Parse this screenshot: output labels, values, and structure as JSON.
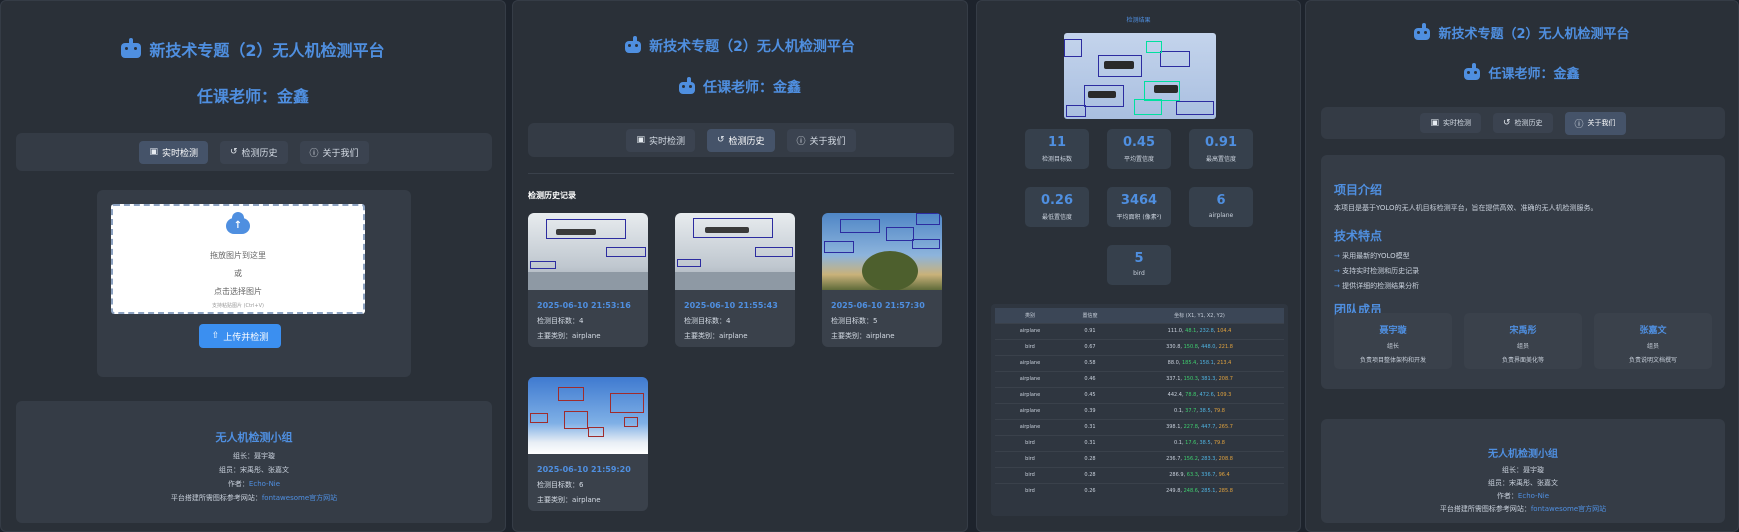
{
  "app": {
    "title": "新技术专题（2）无人机检测平台",
    "teacher": "任课老师：金鑫"
  },
  "nav": {
    "realtime": "实时检测",
    "history": "检测历史",
    "about": "关于我们"
  },
  "upload": {
    "drag_text": "拖放图片到这里",
    "or_text": "或",
    "click_text": "点击选择图片",
    "hint": "支持粘贴图片 (Ctrl+V)",
    "button": "上传并检测"
  },
  "team": {
    "title": "无人机检测小组",
    "leader": "组长：聂宇璇",
    "members": "组员：宋禹彤、张嘉文",
    "author_prefix": "作者：",
    "author_link": "Echo-Nie",
    "ref_prefix": "平台搭建所需图标参考网站：",
    "ref_link": "fontawesome官方网站"
  },
  "history": {
    "heading": "检测历史记录",
    "count_label": "检测目标数：",
    "class_label": "主要类别：",
    "records": [
      {
        "date": "2025-06-10 21:53:16",
        "count": "4",
        "class": "airplane"
      },
      {
        "date": "2025-06-10 21:55:43",
        "count": "4",
        "class": "airplane"
      },
      {
        "date": "2025-06-10 21:57:30",
        "count": "5",
        "class": "airplane"
      },
      {
        "date": "2025-06-10 21:59:20",
        "count": "6",
        "class": "airplane"
      }
    ]
  },
  "result": {
    "image_title": "检测结果",
    "stats": [
      {
        "value": "11",
        "label": "检测目标数"
      },
      {
        "value": "0.45",
        "label": "平均置信度"
      },
      {
        "value": "0.91",
        "label": "最高置信度"
      },
      {
        "value": "0.26",
        "label": "最低置信度"
      },
      {
        "value": "3464",
        "label": "平均面积 (像素²)"
      },
      {
        "value": "6",
        "label": "airplane"
      },
      {
        "value": "5",
        "label": "bird"
      }
    ],
    "table_headers": [
      "类别",
      "置信度",
      "坐标 (X1, Y1, X2, Y2)"
    ],
    "rows": [
      {
        "cls": "airplane",
        "conf": "0.91",
        "x1": "111.0",
        "y1": "48.1",
        "x2": "232.8",
        "y2": "104.4"
      },
      {
        "cls": "bird",
        "conf": "0.67",
        "x1": "330.8",
        "y1": "150.8",
        "x2": "448.0",
        "y2": "221.8"
      },
      {
        "cls": "airplane",
        "conf": "0.58",
        "x1": "88.0",
        "y1": "185.4",
        "x2": "158.1",
        "y2": "213.4"
      },
      {
        "cls": "airplane",
        "conf": "0.46",
        "x1": "337.1",
        "y1": "150.3",
        "x2": "381.3",
        "y2": "208.7"
      },
      {
        "cls": "airplane",
        "conf": "0.45",
        "x1": "442.4",
        "y1": "78.8",
        "x2": "472.6",
        "y2": "109.3"
      },
      {
        "cls": "airplane",
        "conf": "0.39",
        "x1": "0.1",
        "y1": "37.7",
        "x2": "38.5",
        "y2": "79.8"
      },
      {
        "cls": "airplane",
        "conf": "0.31",
        "x1": "398.1",
        "y1": "227.8",
        "x2": "447.7",
        "y2": "265.7"
      },
      {
        "cls": "bird",
        "conf": "0.31",
        "x1": "0.1",
        "y1": "17.6",
        "x2": "38.5",
        "y2": "79.8"
      },
      {
        "cls": "bird",
        "conf": "0.28",
        "x1": "236.7",
        "y1": "156.2",
        "x2": "283.3",
        "y2": "208.8"
      },
      {
        "cls": "bird",
        "conf": "0.28",
        "x1": "286.9",
        "y1": "63.3",
        "x2": "336.7",
        "y2": "96.4"
      },
      {
        "cls": "bird",
        "conf": "0.26",
        "x1": "249.8",
        "y1": "248.6",
        "x2": "285.1",
        "y2": "285.8"
      }
    ]
  },
  "about": {
    "intro_title": "项目介绍",
    "intro_text": "本项目是基于YOLO的无人机目标检测平台，旨在提供高效、准确的无人机检测服务。",
    "features_title": "技术特点",
    "features": [
      "采用最新的YOLO模型",
      "支持实时检测和历史记录",
      "提供详细的检测结果分析"
    ],
    "members_title": "团队成员",
    "members": [
      {
        "name": "聂宇璇",
        "role": "组长",
        "duty": "负责项目整体架构和开发"
      },
      {
        "name": "宋禹彤",
        "role": "组员",
        "duty": "负责界面美化等"
      },
      {
        "name": "张嘉文",
        "role": "组员",
        "duty": "负责说明文档撰写"
      }
    ]
  }
}
